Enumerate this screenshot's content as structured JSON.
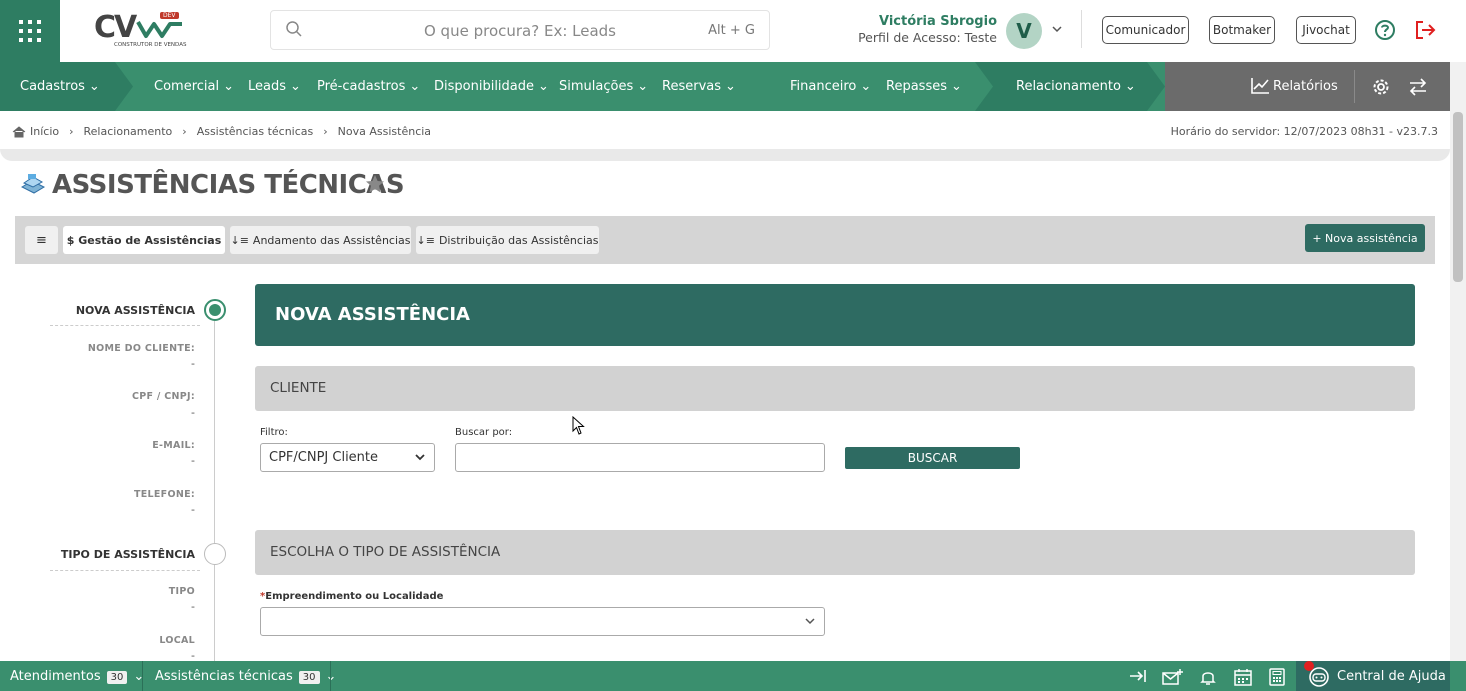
{
  "header": {
    "logo_text": "CV",
    "logo_sub": "CONSTRUTOR DE VENDAS",
    "logo_badge": "DEV",
    "search_placeholder": "O que procura? Ex: Leads",
    "search_shortcut": "Alt + G",
    "user_name": "Victória Sbrogio",
    "user_role": "Perfil de Acesso: Teste",
    "avatar_letter": "V",
    "buttons": [
      "Comunicador",
      "Botmaker",
      "Jivochat"
    ]
  },
  "nav": {
    "items": [
      "Cadastros",
      "Comercial",
      "Leads",
      "Pré-cadastros",
      "Disponibilidade",
      "Simulações",
      "Reservas",
      "Financeiro",
      "Repasses",
      "Relacionamento"
    ],
    "reports": "Relatórios"
  },
  "breadcrumb": [
    "Início",
    "Relacionamento",
    "Assistências técnicas",
    "Nova Assistência"
  ],
  "server_time": "Horário do servidor: 12/07/2023 08h31 - v23.7.3",
  "page_title": "ASSISTÊNCIAS TÉCNICAS",
  "tabs": {
    "menu": "≡",
    "gestao": "$ Gestão de Assistências",
    "andamento": "Andamento das Assistências",
    "distribuicao": "Distribuição das Assistências",
    "new_button": "+ Nova assistência"
  },
  "stepper": {
    "step1": "NOVA ASSISTÊNCIA",
    "step1_fields": [
      {
        "label": "NOME DO CLIENTE:",
        "value": "-"
      },
      {
        "label": "CPF / CNPJ:",
        "value": "-"
      },
      {
        "label": "E-MAIL:",
        "value": "-"
      },
      {
        "label": "TELEFONE:",
        "value": "-"
      }
    ],
    "step2": "TIPO DE ASSISTÊNCIA",
    "step2_fields": [
      {
        "label": "TIPO",
        "value": "-"
      },
      {
        "label": "LOCAL",
        "value": "-"
      }
    ]
  },
  "form": {
    "header": "NOVA ASSISTÊNCIA",
    "section_client": "CLIENTE",
    "filter_label": "Filtro:",
    "filter_value": "CPF/CNPJ Cliente",
    "search_label": "Buscar por:",
    "search_value": "",
    "search_button": "BUSCAR",
    "section_type": "ESCOLHA O TIPO DE ASSISTÊNCIA",
    "empreendimento_label": "Empreendimento ou Localidade",
    "required_mark": "*",
    "empreendimento_value": ""
  },
  "footer": {
    "atendimentos": "Atendimentos",
    "atendimentos_count": "30",
    "assistencias": "Assistências técnicas",
    "assistencias_count": "30",
    "help_center": "Central de Ajuda"
  },
  "colors": {
    "nav_green": "#3a8f6e",
    "dark_teal": "#2e6b62",
    "section_gray": "#d2d2d2"
  }
}
